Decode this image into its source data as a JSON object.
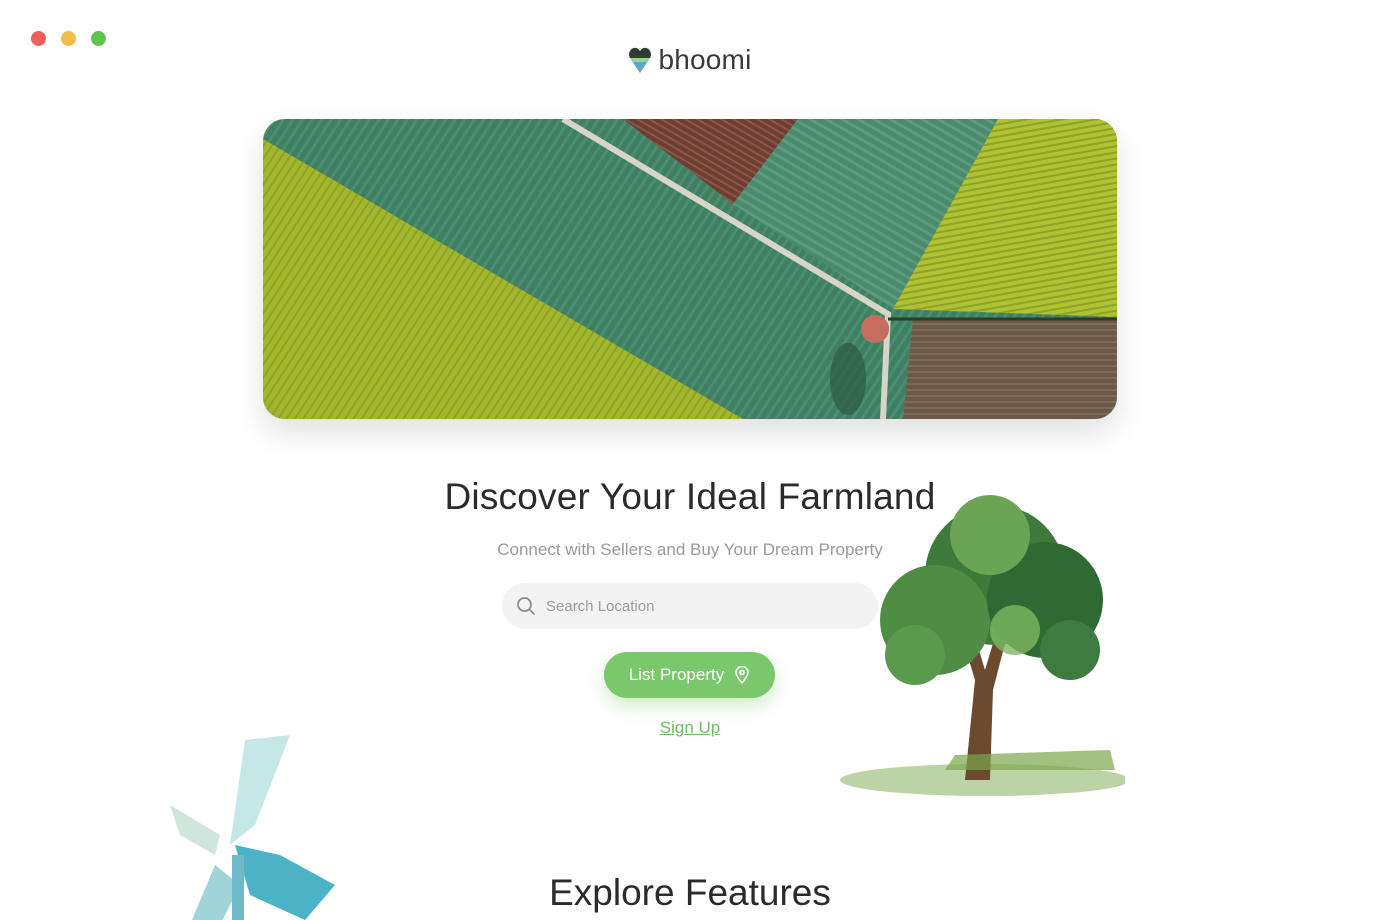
{
  "app": {
    "brand": "bhoomi"
  },
  "hero": {
    "image": "aerial-farmland-fields"
  },
  "main": {
    "headline": "Discover Your Ideal Farmland",
    "subline": "Connect with Sellers and Buy Your Dream Property",
    "search": {
      "placeholder": "Search Location",
      "value": ""
    },
    "list_button": "List Property",
    "signup_link": "Sign Up"
  },
  "features": {
    "title": "Explore Features"
  },
  "colors": {
    "accent": "#79c96a",
    "link": "#6cbf5e",
    "traffic_close": "#ec5f5d",
    "traffic_min": "#f3bd4b",
    "traffic_max": "#5cc44f"
  },
  "icons": {
    "logo": "heart-pin-logo-icon",
    "search": "search-icon",
    "list_button": "location-pin-icon",
    "decor_tree": "tree-illustration",
    "decor_windmill": "windmill-illustration"
  }
}
